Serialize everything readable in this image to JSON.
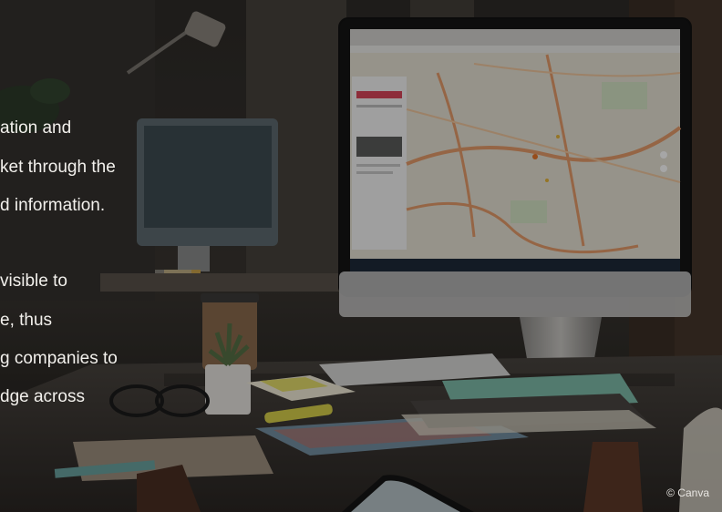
{
  "overlay": {
    "paragraph1": [
      "ation and",
      "ket through the",
      "d information."
    ],
    "paragraph2": [
      "visible to",
      "e, thus",
      "g companies to",
      "dge across"
    ]
  },
  "credit": "© Canva",
  "colors": {
    "background": "#1f1d1b",
    "desk": "#3a3530",
    "map_land": "#e6e2d4",
    "map_road": "#e59c6a",
    "accent_red": "#d9465a"
  },
  "icons": [
    "map-pin-icon",
    "zoom-in-icon",
    "zoom-out-icon"
  ]
}
